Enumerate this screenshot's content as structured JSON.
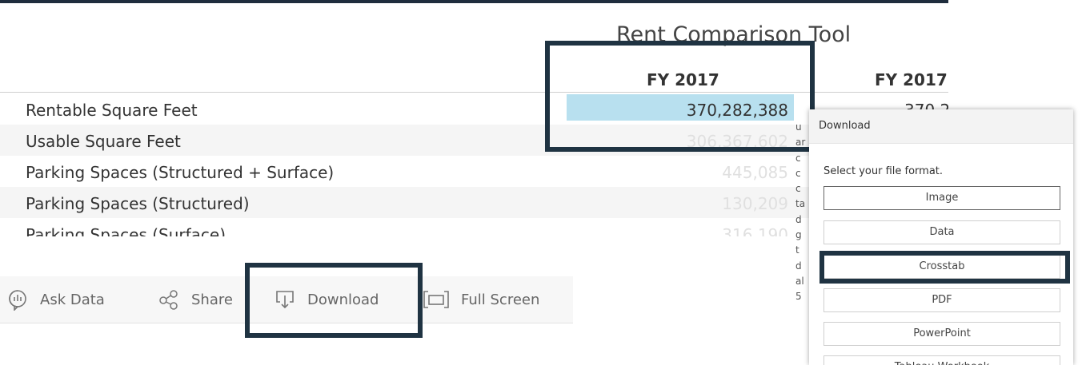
{
  "table": {
    "title": "Rent Comparison Tool",
    "column_headers": [
      "FY 2017",
      "FY 2017"
    ],
    "rows": [
      {
        "label": "Rentable Square Feet",
        "value": "370,282,388",
        "value2": "370,2"
      },
      {
        "label": "Usable Square Feet",
        "value": "306,367,602",
        "value2": ""
      },
      {
        "label": "Parking Spaces (Structured + Surface)",
        "value": "445,085",
        "value2": ""
      },
      {
        "label": "Parking Spaces (Structured)",
        "value": "130,209",
        "value2": ""
      },
      {
        "label": "Parking Spaces (Surface)",
        "value": "316,190",
        "value2": ""
      }
    ],
    "fragment_column": [
      "u",
      "ar",
      "c",
      "c",
      "c",
      "ta",
      "d",
      "g",
      "t",
      "d",
      "al",
      "5"
    ]
  },
  "toolbar": {
    "items": [
      {
        "label": "Ask Data",
        "icon": "ask-data-icon"
      },
      {
        "label": "Share",
        "icon": "share-icon"
      },
      {
        "label": "Download",
        "icon": "download-icon"
      },
      {
        "label": "Full Screen",
        "icon": "full-screen-icon"
      }
    ]
  },
  "download_panel": {
    "title": "Download",
    "prompt": "Select your file format.",
    "options": [
      "Image",
      "Data",
      "Crosstab",
      "PDF",
      "PowerPoint",
      "Tableau Workbook"
    ],
    "selected": "Crosstab"
  },
  "colors": {
    "highlight_cell": "#b8e0ef",
    "callout_border": "#1f3342",
    "top_bar": "#1f2d3d"
  }
}
